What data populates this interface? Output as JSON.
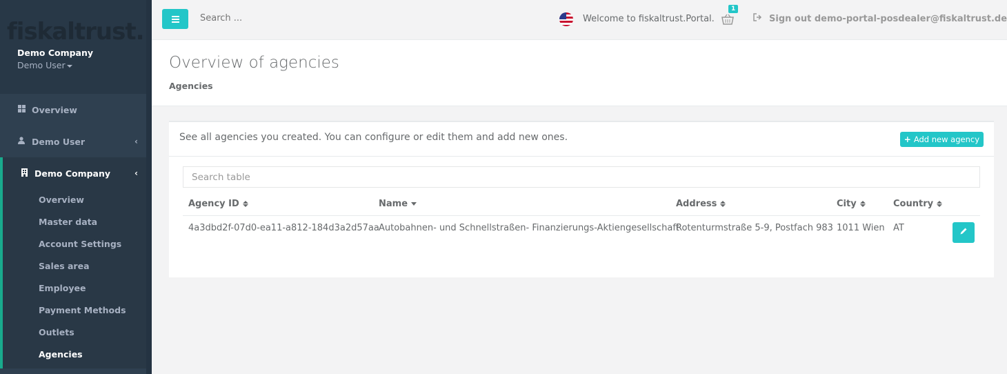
{
  "sidebar": {
    "logo": "fiskaltrust.",
    "company": "Demo Company",
    "user": "Demo User",
    "nav": [
      {
        "label": "Overview",
        "icon": "th-large-icon"
      },
      {
        "label": "Demo User",
        "icon": "user-icon"
      },
      {
        "label": "Demo Company",
        "icon": "building-icon"
      }
    ],
    "subnav": [
      {
        "label": "Overview"
      },
      {
        "label": "Master data"
      },
      {
        "label": "Account Settings"
      },
      {
        "label": "Sales area"
      },
      {
        "label": "Employee"
      },
      {
        "label": "Payment Methods"
      },
      {
        "label": "Outlets"
      },
      {
        "label": "Agencies"
      }
    ]
  },
  "topbar": {
    "search_placeholder": "Search ...",
    "welcome": "Welcome to fiskaltrust.Portal.",
    "basket_count": "1",
    "signout": "Sign out demo-portal-posdealer@fiskaltrust.de"
  },
  "heading": {
    "title": "Overview of agencies",
    "breadcrumb": "Agencies"
  },
  "panel": {
    "description": "See all agencies you created. You can configure or edit them and add new ones.",
    "add_label": "Add new agency",
    "table_search_placeholder": "Search table"
  },
  "table": {
    "columns": [
      "Agency ID",
      "Name",
      "Address",
      "City",
      "Country"
    ],
    "rows": [
      {
        "agency_id": "4a3dbd2f-07d0-ea11-a812-184d3a2d57aa",
        "name": "Autobahnen- und Schnellstraßen- Finanzierungs-Aktiengesellschaft",
        "address": "Rotenturmstraße 5-9, Postfach 983",
        "city": "1011 Wien",
        "country": "AT"
      }
    ]
  },
  "colors": {
    "accent": "#23c6c8",
    "sidebar": "#2f4050",
    "active_border": "#19aa8d"
  }
}
